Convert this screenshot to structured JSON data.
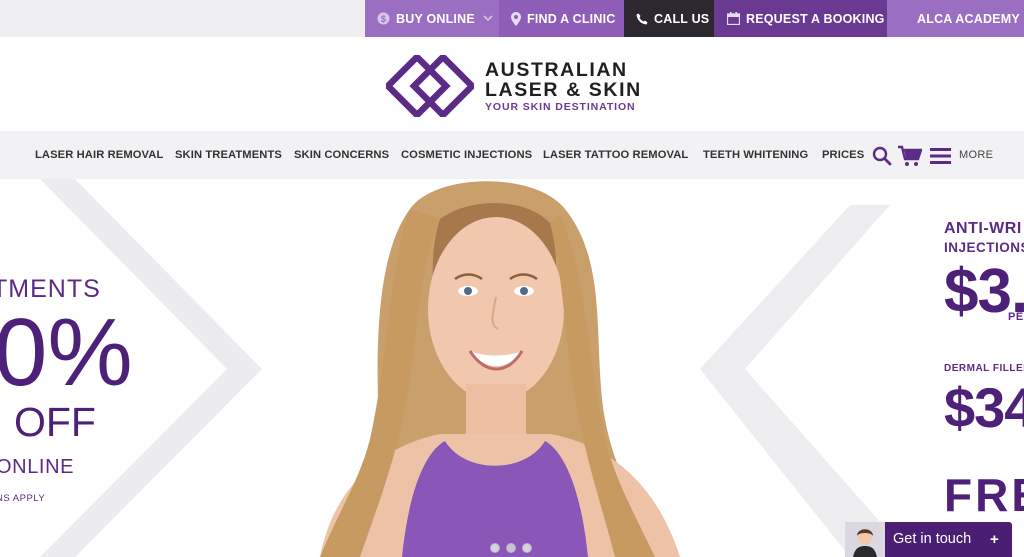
{
  "topbar": {
    "buy_online": "BUY ONLINE",
    "find_clinic": "FIND A CLINIC",
    "call_us": "CALL US",
    "request_booking": "REQUEST A BOOKING",
    "academy": "ALCA ACADEMY"
  },
  "logo": {
    "line1": "AUSTRALIAN",
    "line2": "LASER & SKIN",
    "tagline": "YOUR SKIN DESTINATION"
  },
  "nav": {
    "items": [
      {
        "label": "LASER HAIR REMOVAL"
      },
      {
        "label": "SKIN TREATMENTS"
      },
      {
        "label": "SKIN CONCERNS"
      },
      {
        "label": "COSMETIC INJECTIONS"
      },
      {
        "label": "LASER TATTOO REMOVAL"
      },
      {
        "label": "TEETH WHITENING"
      },
      {
        "label": "PRICES"
      }
    ],
    "more": "MORE",
    "icons": [
      "search-icon",
      "cart-icon",
      "menu-icon"
    ]
  },
  "hero": {
    "left": {
      "line1": "TMENTS",
      "big": "0%",
      "off": "OFF",
      "online": "ONLINE",
      "conditions": "NS APPLY"
    },
    "right": {
      "heading1": "ANTI-WRI",
      "heading2": "INJECTIONS",
      "price1": "$3.",
      "per": "PE",
      "filler_label": "DERMAL FILLEI",
      "price2": "$34",
      "free": "FRE"
    },
    "slides": {
      "count": 3,
      "active": 1
    }
  },
  "chat": {
    "label": "Get in touch",
    "plus": "+"
  },
  "colors": {
    "brand_purple": "#6a3a93",
    "dark_purple": "#4e2178",
    "light_purple": "#9a6ec0",
    "dark": "#2b2830"
  }
}
